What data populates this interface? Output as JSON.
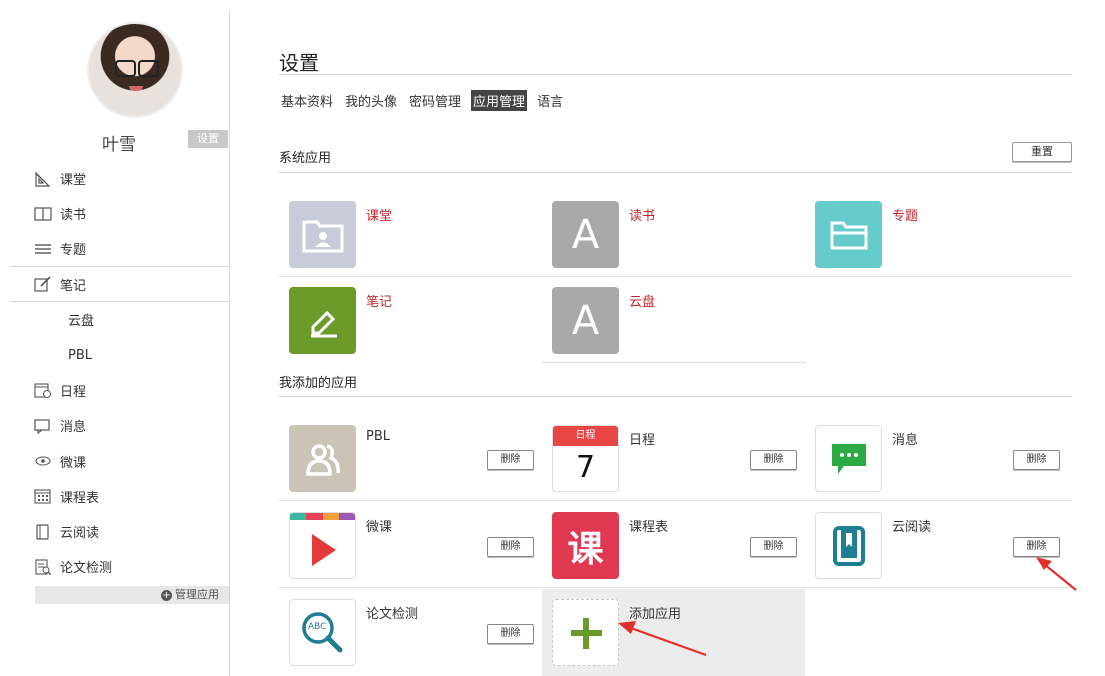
{
  "user": {
    "name": "叶雪",
    "settings_tag": "设置"
  },
  "nav": {
    "items": [
      {
        "label": "课堂",
        "icon": "classroom-icon"
      },
      {
        "label": "读书",
        "icon": "book-icon"
      },
      {
        "label": "专题",
        "icon": "topic-icon"
      },
      {
        "label": "笔记",
        "icon": "note-icon"
      },
      {
        "label": "云盘",
        "icon": ""
      },
      {
        "label": "PBL",
        "icon": ""
      },
      {
        "label": "日程",
        "icon": "calendar-icon"
      },
      {
        "label": "消息",
        "icon": "message-icon"
      },
      {
        "label": "微课",
        "icon": "eye-icon"
      },
      {
        "label": "课程表",
        "icon": "timetable-icon"
      },
      {
        "label": "云阅读",
        "icon": "reader-icon"
      },
      {
        "label": "论文检测",
        "icon": "paper-check-icon"
      }
    ],
    "manage_label": "管理应用"
  },
  "page": {
    "title": "设置",
    "tabs": [
      "基本资料",
      "我的头像",
      "密码管理",
      "应用管理",
      "语言"
    ],
    "active_tab": "应用管理"
  },
  "system_apps": {
    "label": "系统应用",
    "reset_label": "重置",
    "apps": [
      {
        "name": "课堂",
        "icon": "classroom-folder-icon",
        "color": "#c8ccd8"
      },
      {
        "name": "读书",
        "icon": "letter-a-icon",
        "letter": "A",
        "color": "#a9a9a9"
      },
      {
        "name": "专题",
        "icon": "folder-icon",
        "color": "#66cbcb"
      },
      {
        "name": "笔记",
        "icon": "pencil-icon",
        "color": "#6c9a2b"
      },
      {
        "name": "云盘",
        "icon": "letter-a-icon",
        "letter": "A",
        "color": "#a9a9a9"
      }
    ]
  },
  "my_apps": {
    "label": "我添加的应用",
    "delete_label": "删除",
    "apps": [
      {
        "name": "PBL",
        "icon": "people-icon",
        "color": "#cbc3b6"
      },
      {
        "name": "日程",
        "icon": "calendar-page-icon",
        "badge": "日程",
        "day": "7",
        "color": "#e84545"
      },
      {
        "name": "消息",
        "icon": "chat-bubble-icon",
        "color": "#2eaa44"
      },
      {
        "name": "微课",
        "icon": "play-icon",
        "color": "#e03a3a"
      },
      {
        "name": "课程表",
        "icon": "ke-character-icon",
        "character": "课",
        "color": "#e03a52"
      },
      {
        "name": "云阅读",
        "icon": "book-reader-icon",
        "color": "#1f7e91"
      },
      {
        "name": "论文检测",
        "icon": "abc-magnifier-icon",
        "abc": "ABC",
        "color": "#1f7e91"
      }
    ],
    "add_label": "添加应用"
  }
}
